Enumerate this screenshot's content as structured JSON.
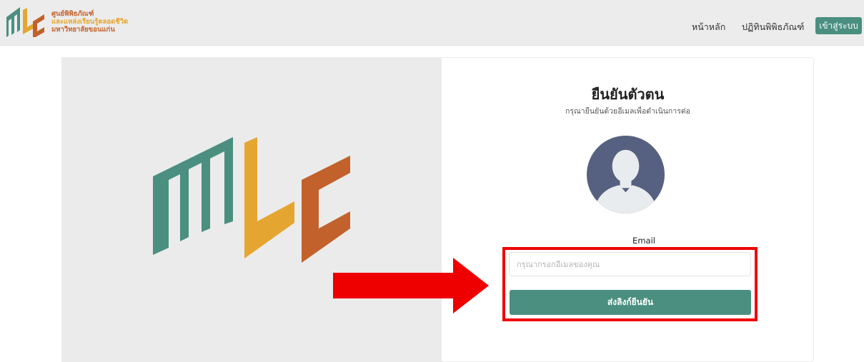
{
  "navbar": {
    "brand": {
      "line1": "ศูนย์พิพิธภัณฑ์",
      "line2": "และแหล่งเรียนรู้ตลอดชีวิต",
      "line3": "มหาวิทยาลัยขอนแก่น"
    },
    "links": {
      "home": "หน้าหลัก",
      "calendar": "ปฏิทินพิพิธภัณฑ์"
    },
    "login_label": "เข้าสู่ระบบ"
  },
  "verify": {
    "title": "ยืนยันตัวตน",
    "subtitle": "กรุณายืนยันด้วยอีเมลเพื่อดำเนินการต่อ",
    "email_label": "Email",
    "email_placeholder": "กรุณากรอกอีเมลของคุณ",
    "email_value": "",
    "submit_label": "ส่งลิงก์ยืนยัน"
  },
  "colors": {
    "teal": "#4a8f80",
    "orange": "#e5a631",
    "rust": "#c2612b",
    "highlight": "#ee0000",
    "avatar_bg": "#566181"
  },
  "icons": {
    "avatar": "user-avatar-icon",
    "arrow": "red-arrow-right-icon"
  }
}
